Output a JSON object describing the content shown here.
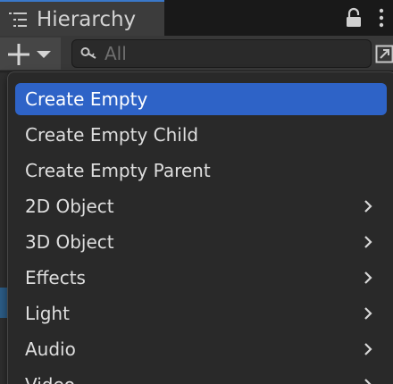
{
  "panel": {
    "title": "Hierarchy",
    "icons": {
      "hierarchy": "hierarchy-list-icon",
      "lock": "lock-icon",
      "more": "more-vertical-icon"
    }
  },
  "toolbar": {
    "add_icon": "plus-icon",
    "dropdown_icon": "dropdown-arrow-icon",
    "search": {
      "placeholder": "All",
      "value": "",
      "icon": "search-icon"
    },
    "expand_icon": "expand-window-icon"
  },
  "menu": {
    "items": [
      {
        "label": "Create Empty",
        "highlighted": true,
        "submenu": false
      },
      {
        "label": "Create Empty Child",
        "highlighted": false,
        "submenu": false
      },
      {
        "label": "Create Empty Parent",
        "highlighted": false,
        "submenu": false
      },
      {
        "label": "2D Object",
        "highlighted": false,
        "submenu": true
      },
      {
        "label": "3D Object",
        "highlighted": false,
        "submenu": true
      },
      {
        "label": "Effects",
        "highlighted": false,
        "submenu": true
      },
      {
        "label": "Light",
        "highlighted": false,
        "submenu": true
      },
      {
        "label": "Audio",
        "highlighted": false,
        "submenu": true
      },
      {
        "label": "Video",
        "highlighted": false,
        "submenu": true
      }
    ]
  },
  "colors": {
    "accent_highlight": "#2e63c7",
    "tab_accent": "#3a78c9",
    "menu_background": "#292929",
    "text": "#dedede"
  }
}
